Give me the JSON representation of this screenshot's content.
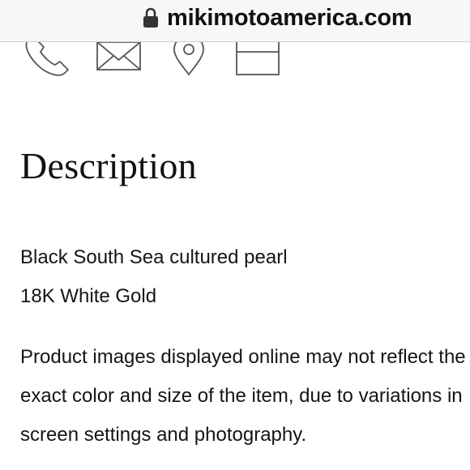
{
  "browser": {
    "url_domain": "mikimotoamerica.com",
    "lock_icon": "lock-icon"
  },
  "contact_icons": [
    "phone-icon",
    "mail-icon",
    "location-pin-icon",
    "card-icon"
  ],
  "section": {
    "heading": "Description",
    "details": [
      "Black South Sea cultured pearl",
      "18K White Gold"
    ],
    "disclaimer_lines": [
      "Product images displayed online may not reflect the",
      "exact color and size of the item, due to variations in",
      "screen settings and photography."
    ]
  },
  "colors": {
    "text": "#151515",
    "icon_stroke": "#555555",
    "url_bar_bg": "#f7f7f7"
  }
}
